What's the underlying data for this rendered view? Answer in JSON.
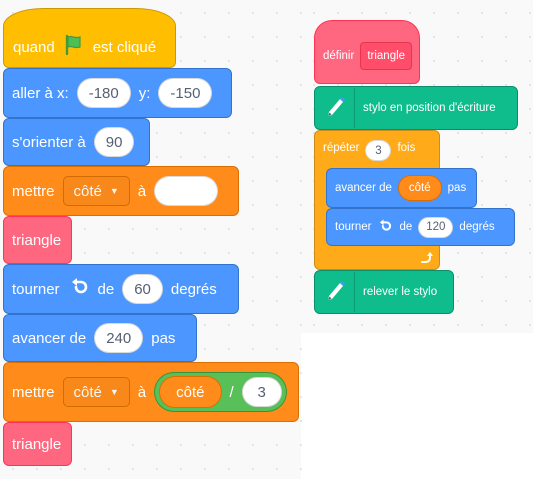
{
  "left_script": {
    "event": {
      "prefix": "quand",
      "suffix": "est cliqué",
      "flag_icon": "green-flag-icon"
    },
    "goto": {
      "label": "aller à x:",
      "x": "-180",
      "y_label": "y:",
      "y": "-150"
    },
    "point": {
      "label": "s'orienter à",
      "value": "90"
    },
    "set1": {
      "label": "mettre",
      "var": "côté",
      "to": "à",
      "value": ""
    },
    "call1": {
      "label": "triangle"
    },
    "turn": {
      "label": "tourner",
      "icon": "rotate-left-icon",
      "of": "de",
      "value": "60",
      "unit": "degrés"
    },
    "move": {
      "label": "avancer de",
      "value": "240",
      "unit": "pas"
    },
    "set2": {
      "label": "mettre",
      "var": "côté",
      "to": "à",
      "reporter": "côté",
      "operator": "/",
      "divisor": "3"
    },
    "call2": {
      "label": "triangle"
    }
  },
  "right_script": {
    "define": {
      "label": "définir",
      "name": "triangle"
    },
    "pen_down": {
      "label": "stylo en position d'écriture",
      "icon": "pen-icon"
    },
    "repeat": {
      "label": "répéter",
      "count": "3",
      "suffix": "fois",
      "loop_icon": "loop-arrow-icon"
    },
    "move": {
      "label": "avancer de",
      "reporter": "côté",
      "unit": "pas"
    },
    "turn": {
      "label": "tourner",
      "icon": "rotate-left-icon",
      "of": "de",
      "value": "120",
      "unit": "degrés"
    },
    "pen_up": {
      "label": "relever le stylo",
      "icon": "pen-icon"
    }
  },
  "colors": {
    "events": "#ffbf00",
    "motion": "#4c97ff",
    "variables": "#ff8c1a",
    "my_blocks": "#ff6680",
    "pen": "#0fbd8c",
    "control": "#ffab19",
    "operators": "#59c059"
  }
}
